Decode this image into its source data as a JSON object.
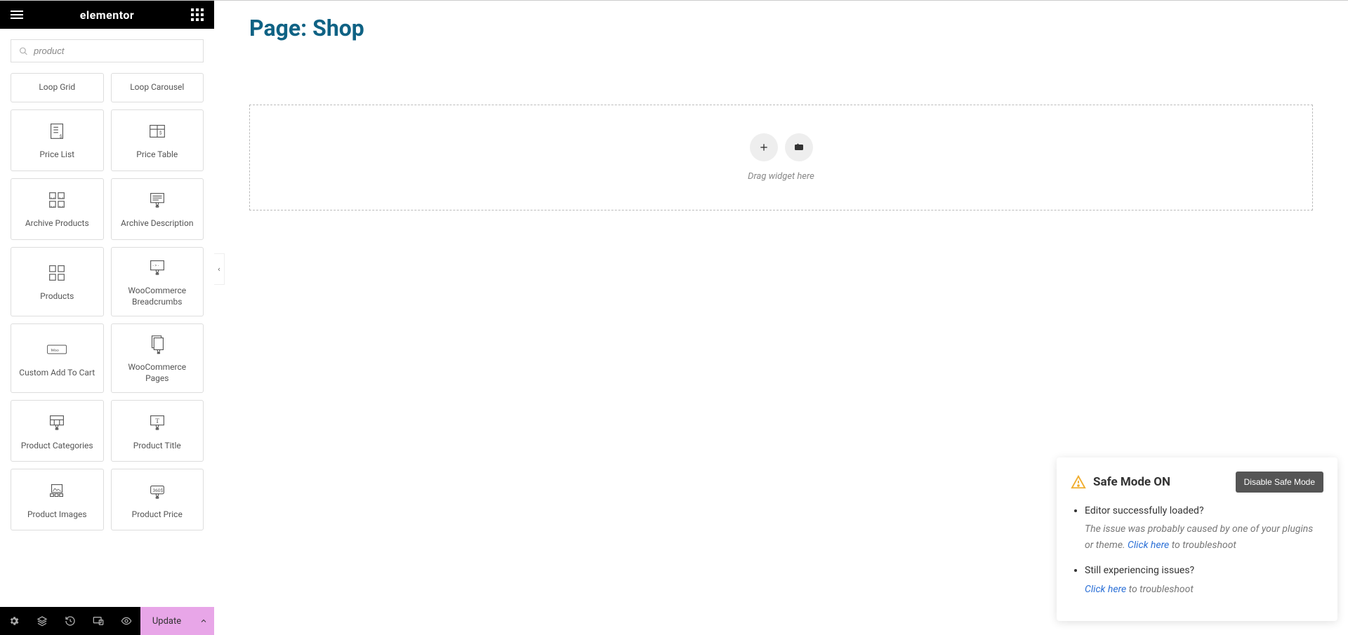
{
  "header": {
    "logo": "elementor"
  },
  "search": {
    "value": "product"
  },
  "widgets": [
    {
      "label": "Loop Grid",
      "icon": null
    },
    {
      "label": "Loop Carousel",
      "icon": null
    },
    {
      "label": "Price List",
      "icon": "price-list"
    },
    {
      "label": "Price Table",
      "icon": "price-table"
    },
    {
      "label": "Archive Products",
      "icon": "archive-products"
    },
    {
      "label": "Archive Description",
      "icon": "archive-description"
    },
    {
      "label": "Products",
      "icon": "products"
    },
    {
      "label": "WooCommerce Breadcrumbs",
      "icon": "breadcrumbs"
    },
    {
      "label": "Custom Add To Cart",
      "icon": "add-to-cart"
    },
    {
      "label": "WooCommerce Pages",
      "icon": "wc-pages"
    },
    {
      "label": "Product Categories",
      "icon": "product-categories"
    },
    {
      "label": "Product Title",
      "icon": "product-title"
    },
    {
      "label": "Product Images",
      "icon": "product-images"
    },
    {
      "label": "Product Price",
      "icon": "product-price"
    }
  ],
  "footer": {
    "update_label": "Update"
  },
  "page": {
    "title": "Page: Shop"
  },
  "drop": {
    "hint": "Drag widget here"
  },
  "notice": {
    "title": "Safe Mode ON",
    "disable_label": "Disable Safe Mode",
    "items": [
      {
        "q": "Editor successfully loaded?",
        "sub_pre": "The issue was probably caused by one of your plugins or theme. ",
        "link": "Click here",
        "sub_post": " to troubleshoot"
      },
      {
        "q": "Still experiencing issues?",
        "sub_pre": "",
        "link": "Click here",
        "sub_post": " to troubleshoot"
      }
    ]
  }
}
